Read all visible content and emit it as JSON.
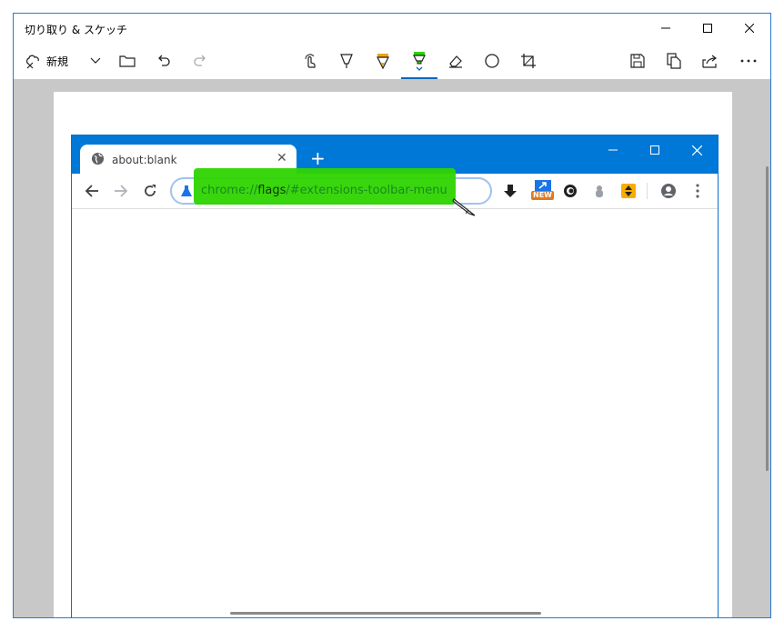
{
  "window": {
    "title": "切り取り & スケッチ",
    "accent": "#2b78d4"
  },
  "toolbar": {
    "new_label": "新規",
    "icons": [
      "new-snip-icon",
      "chevron-down-icon",
      "folder-icon",
      "undo-icon",
      "redo-icon",
      "touch-writing-icon",
      "ballpoint-pen-icon",
      "pencil-icon",
      "highlighter-icon",
      "eraser-icon",
      "ruler-icon",
      "crop-icon",
      "save-icon",
      "copy-icon",
      "share-icon",
      "more-icon"
    ],
    "active_tool": "highlighter",
    "highlighter_color": "#2ed400"
  },
  "chrome": {
    "tab_title": "about:blank",
    "new_tab": "+",
    "url_prefix": "chrome://",
    "url_host": "flags",
    "url_rest": "/#extensions-toolbar-menu",
    "badge_new": "NEW",
    "tabstrip_color": "#0078d7"
  }
}
